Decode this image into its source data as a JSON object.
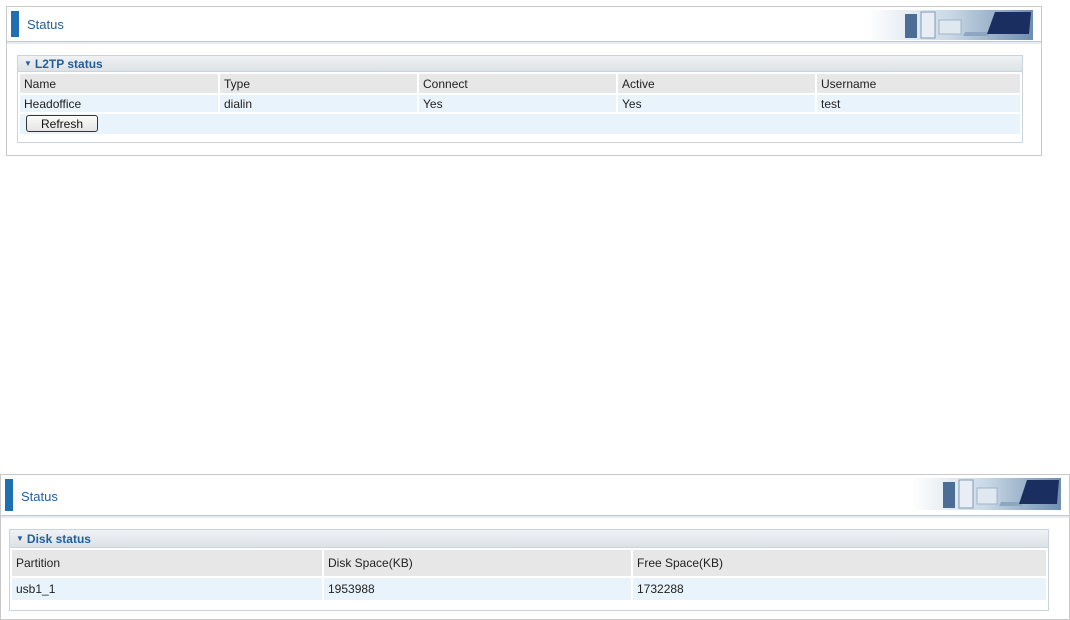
{
  "panel1": {
    "title": "Status",
    "section_title": "L2TP status",
    "columns": [
      "Name",
      "Type",
      "Connect",
      "Active",
      "Username"
    ],
    "rows": [
      [
        "Headoffice",
        "dialin",
        "Yes",
        "Yes",
        "test"
      ]
    ],
    "refresh_label": "Refresh"
  },
  "panel2": {
    "title": "Status",
    "section_title": "Disk status",
    "columns": [
      "Partition",
      "Disk Space(KB)",
      "Free Space(KB)"
    ],
    "rows": [
      [
        "usb1_1",
        "1953988",
        "1732288"
      ]
    ]
  },
  "colors": {
    "accent": "#1f6fb2",
    "title_text": "#1f5f9c",
    "header_cell": "#e7e7e7",
    "data_cell": "#e9f3fb"
  }
}
